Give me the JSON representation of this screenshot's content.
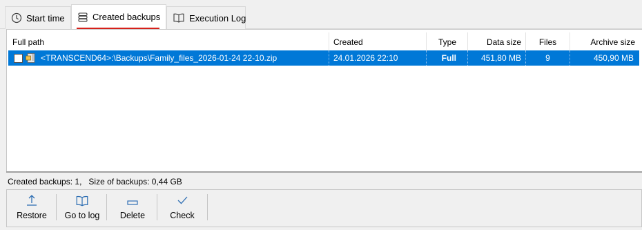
{
  "tabs": [
    {
      "label": "Start time",
      "icon": "clock-icon"
    },
    {
      "label": "Created backups",
      "icon": "database-icon",
      "active": true
    },
    {
      "label": "Execution Log",
      "icon": "book-icon"
    }
  ],
  "table": {
    "columns": [
      "Full path",
      "Created",
      "Type",
      "Data size",
      "Files",
      "Archive size"
    ],
    "rows": [
      {
        "checked": false,
        "path": "<TRANSCEND64>:\\Backups\\Family_files_2026-01-24 22-10.zip",
        "created": "24.01.2026  22:10",
        "type": "Full",
        "data_size": "451,80 MB",
        "files": "9",
        "archive_size": "450,90 MB",
        "selected": true
      }
    ]
  },
  "status": {
    "text": "Created backups: 1,   Size of backups: 0,44 GB"
  },
  "toolbar": {
    "buttons": [
      {
        "label": "Restore",
        "icon": "upload-icon"
      },
      {
        "label": "Go to log",
        "icon": "book-icon"
      },
      {
        "label": "Delete",
        "icon": "minus-icon"
      },
      {
        "label": "Check",
        "icon": "checkmark-icon"
      }
    ]
  },
  "colors": {
    "selection": "#0078d7",
    "active_tab_underline": "#d6201a"
  }
}
